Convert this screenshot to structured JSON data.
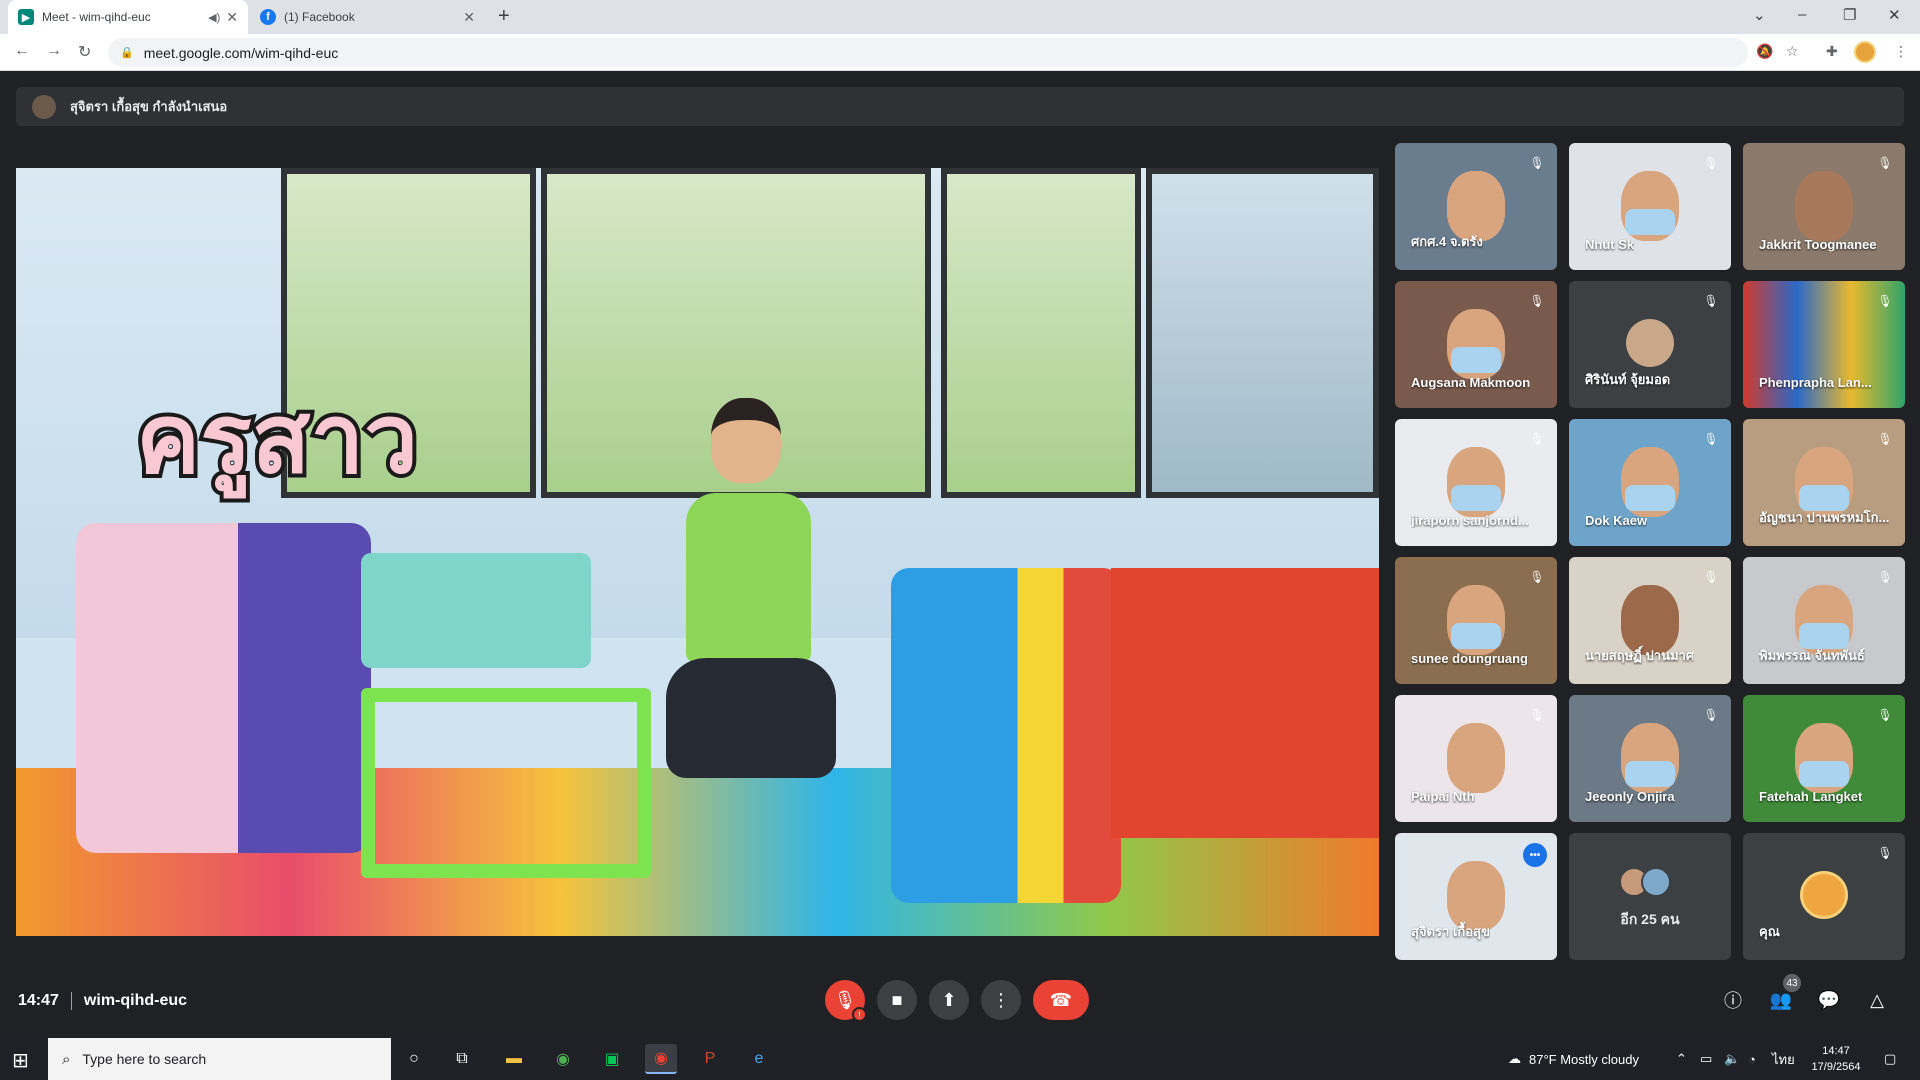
{
  "browser": {
    "tabs": [
      {
        "title": "Meet - wim-qihd-euc",
        "active": true
      },
      {
        "title": "(1) Facebook",
        "active": false
      }
    ],
    "url": "meet.google.com/wim-qihd-euc"
  },
  "meet": {
    "presenting_text": "สุจิตรา เกื้อสุข กำลังนำเสนอ",
    "main_video_caption": "ครูสาว",
    "participants": [
      {
        "name": "ศกศ.4 จ.ตรัง",
        "muted": true
      },
      {
        "name": "Nnut Sk",
        "muted": true
      },
      {
        "name": "Jakkrit Toogmanee",
        "muted": true
      },
      {
        "name": "Augsana Makmoon",
        "muted": true
      },
      {
        "name": "ศิรินันท์ จุ้ยมอด",
        "muted": true
      },
      {
        "name": "Phenprapha Lan...",
        "muted": true
      },
      {
        "name": "jiraporn sanjornd...",
        "muted": true
      },
      {
        "name": "Dok Kaew",
        "muted": true
      },
      {
        "name": "อัญชนา ปานพรหมโก...",
        "muted": true
      },
      {
        "name": "sunee doungruang",
        "muted": true
      },
      {
        "name": "นายสฤษฏิ์ ปานมาศ",
        "muted": true
      },
      {
        "name": "พิมพรรณ จันทพันธ์",
        "muted": true
      },
      {
        "name": "Paipai Nth",
        "muted": true
      },
      {
        "name": "Jeeonly Onjira",
        "muted": true
      },
      {
        "name": "Fatehah Langket",
        "muted": true
      },
      {
        "name": "สุจิตรา เกื้อสุข",
        "muted": false
      },
      {
        "name": "อีก 25 คน",
        "muted": false
      },
      {
        "name": "คุณ",
        "muted": true
      }
    ],
    "time": "14:47",
    "meeting_code": "wim-qihd-euc",
    "people_count": "43"
  },
  "taskbar": {
    "search_placeholder": "Type here to search",
    "weather": "87°F  Mostly cloudy",
    "language": "ไทย",
    "clock_time": "14:47",
    "clock_date": "17/9/2564"
  },
  "colors": {
    "meet_bg": "#202124",
    "end_call": "#ea4335",
    "speaking": "#1a73e8"
  }
}
